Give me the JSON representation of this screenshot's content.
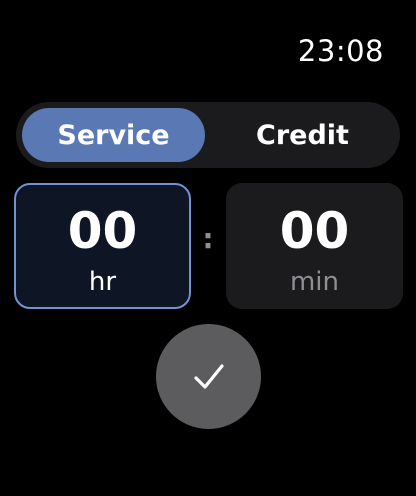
{
  "status_bar": {
    "time": "23:08"
  },
  "mode_selector": {
    "options": [
      {
        "label": "Service",
        "selected": true
      },
      {
        "label": "Credit",
        "selected": false
      }
    ]
  },
  "duration": {
    "hours": {
      "value": "00",
      "unit": "hr",
      "focused": true
    },
    "separator": ":",
    "minutes": {
      "value": "00",
      "unit": "min",
      "focused": false
    }
  },
  "confirm_button": {
    "icon": "checkmark-icon"
  },
  "colors": {
    "background": "#000000",
    "accent": "#5a78b3",
    "focus_border": "#7193cf",
    "control_surface": "#1b1b1d",
    "confirm_button": "#5c5c5f",
    "secondary_text": "#8e8e93"
  }
}
